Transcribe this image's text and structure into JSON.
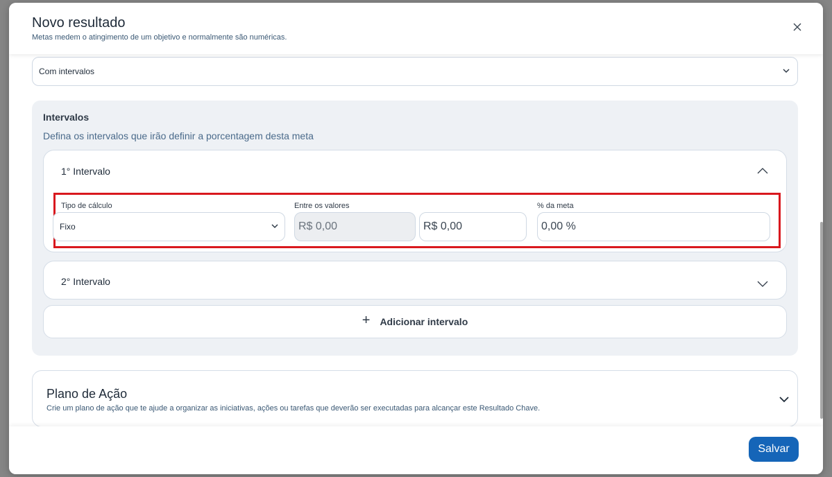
{
  "modal": {
    "title": "Novo resultado",
    "subtitle": "Metas medem o atingimento de um objetivo e normalmente são numéricas."
  },
  "measurement_select": {
    "value": "Com intervalos"
  },
  "intervals": {
    "title": "Intervalos",
    "description": "Defina os intervalos que irão definir a porcentagem desta meta",
    "items": [
      {
        "label": "1° Intervalo",
        "expanded": true,
        "calc_type_label": "Tipo de cálculo",
        "calc_type_value": "Fixo",
        "between_label": "Entre os valores",
        "from_value": "R$ 0,00",
        "to_value": "R$ 0,00",
        "goal_percent_label": "% da meta",
        "goal_percent_value": "0,00 %"
      },
      {
        "label": "2° Intervalo",
        "expanded": false
      }
    ],
    "add_label": "Adicionar intervalo"
  },
  "action_plan": {
    "title": "Plano de Ação",
    "description": "Crie um plano de ação que te ajude a organizar as iniciativas, ações ou tarefas que deverão ser executadas para alcançar este Resultado Chave."
  },
  "footer": {
    "save_label": "Salvar"
  },
  "colors": {
    "primary": "#1565b8",
    "highlight": "#d9181e",
    "panel": "#eef1f5"
  }
}
